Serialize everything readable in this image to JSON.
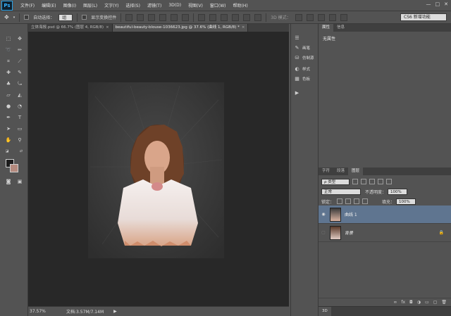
{
  "app": {
    "logo": "Ps"
  },
  "menu": [
    "文件(F)",
    "编辑(E)",
    "图像(I)",
    "图层(L)",
    "文字(Y)",
    "选择(S)",
    "滤镜(T)",
    "3D(D)",
    "视图(V)",
    "窗口(W)",
    "帮助(H)"
  ],
  "window_controls": [
    "—",
    "□",
    "✕"
  ],
  "options": {
    "auto_select_label": "自动选择：",
    "auto_select_value": "组",
    "show_transform_label": "显示变换控件",
    "mode_3d_label": "3D 模式：",
    "workspace": "CS6 新增功能"
  },
  "tabs": [
    {
      "title": "立体海报.psd @ 66.7% (图层 4, RGB/8)",
      "close": "×",
      "active": false
    },
    {
      "title": "beautiful-beauty-blouse-1036623.jpg @ 37.6% (曲线 1, RGB/8) *",
      "close": "×",
      "active": true
    }
  ],
  "status": {
    "zoom": "37.57%",
    "doc_info": "文档:3.57M/7.14M",
    "arrow": "▶"
  },
  "colors": {
    "foreground": "#1c1c1c",
    "background": "#b48a7e",
    "selection": "#5f7590"
  },
  "dock": [
    {
      "icon": "history-icon",
      "glyph": "☰",
      "label": ""
    },
    {
      "icon": "brush-icon",
      "glyph": "✎",
      "label": "画笔"
    },
    {
      "icon": "clone-source-icon",
      "glyph": "⛁",
      "label": "仿制源"
    },
    {
      "icon": "styles-icon",
      "glyph": "◐",
      "label": "样式"
    },
    {
      "icon": "swatches-icon",
      "glyph": "▦",
      "label": "色板"
    },
    {
      "icon": "play-action-icon",
      "glyph": "▶",
      "label": ""
    }
  ],
  "properties": {
    "tabs": [
      "属性",
      "信息"
    ],
    "empty_text": "无属性"
  },
  "layers_panel": {
    "tabs": [
      "字符",
      "段落",
      "图层"
    ],
    "filter_kind": "ρ 类型",
    "blend_mode": "正常",
    "opacity_label": "不透明度：",
    "opacity_value": "100%",
    "lock_label": "锁定：",
    "fill_label": "填充：",
    "fill_value": "100%",
    "layers": [
      {
        "name": "曲线 1",
        "visible": true,
        "selected": true
      },
      {
        "name": "背景",
        "visible": false,
        "selected": false
      }
    ],
    "footer_icons": [
      "link-icon",
      "fx-icon",
      "mask-icon",
      "adjustment-icon",
      "folder-icon",
      "new-layer-icon",
      "trash-icon"
    ],
    "footer_glyphs": [
      "∞",
      "fx",
      "◘",
      "◑",
      "▭",
      "▢",
      "🗑"
    ]
  },
  "bottom_tab": "3D"
}
